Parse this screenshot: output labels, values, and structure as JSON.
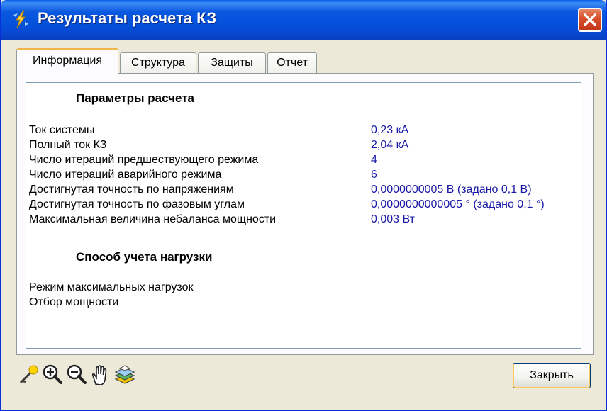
{
  "window": {
    "title": "Результаты расчета КЗ"
  },
  "tabs": [
    {
      "label": "Информация",
      "active": true
    },
    {
      "label": "Структура",
      "active": false
    },
    {
      "label": "Защиты",
      "active": false
    },
    {
      "label": "Отчет",
      "active": false
    }
  ],
  "params": {
    "heading": "Параметры расчета",
    "rows": [
      {
        "label": "Ток системы",
        "value": "0,23 кА"
      },
      {
        "label": "Полный ток КЗ",
        "value": "2,04 кА"
      },
      {
        "label": "Число итераций предшествующего режима",
        "value": "4"
      },
      {
        "label": "Число итераций аварийного режима",
        "value": "6"
      },
      {
        "label": "Достигнутая точность по напряжениям",
        "value": "0,0000000005 В (задано 0,1 В)"
      },
      {
        "label": "Достигнутая точность по фазовым углам",
        "value": "0,0000000000005 ° (задано 0,1 °)"
      },
      {
        "label": "Максимальная величина небаланса мощности",
        "value": "0,003 Вт"
      }
    ]
  },
  "load": {
    "heading": "Способ учета нагрузки",
    "lines": [
      "Режим максимальных нагрузок",
      "Отбор мощности"
    ]
  },
  "toolbar": {
    "icons": [
      "select-tool-icon",
      "zoom-in-icon",
      "zoom-out-icon",
      "pan-hand-icon",
      "layers-icon"
    ]
  },
  "buttons": {
    "close_label": "Закрыть"
  },
  "colors": {
    "value_text": "#1a1aa6",
    "titlebar": "#0a58e0",
    "close": "#d9512c",
    "tab_highlight": "#f1b54a"
  }
}
